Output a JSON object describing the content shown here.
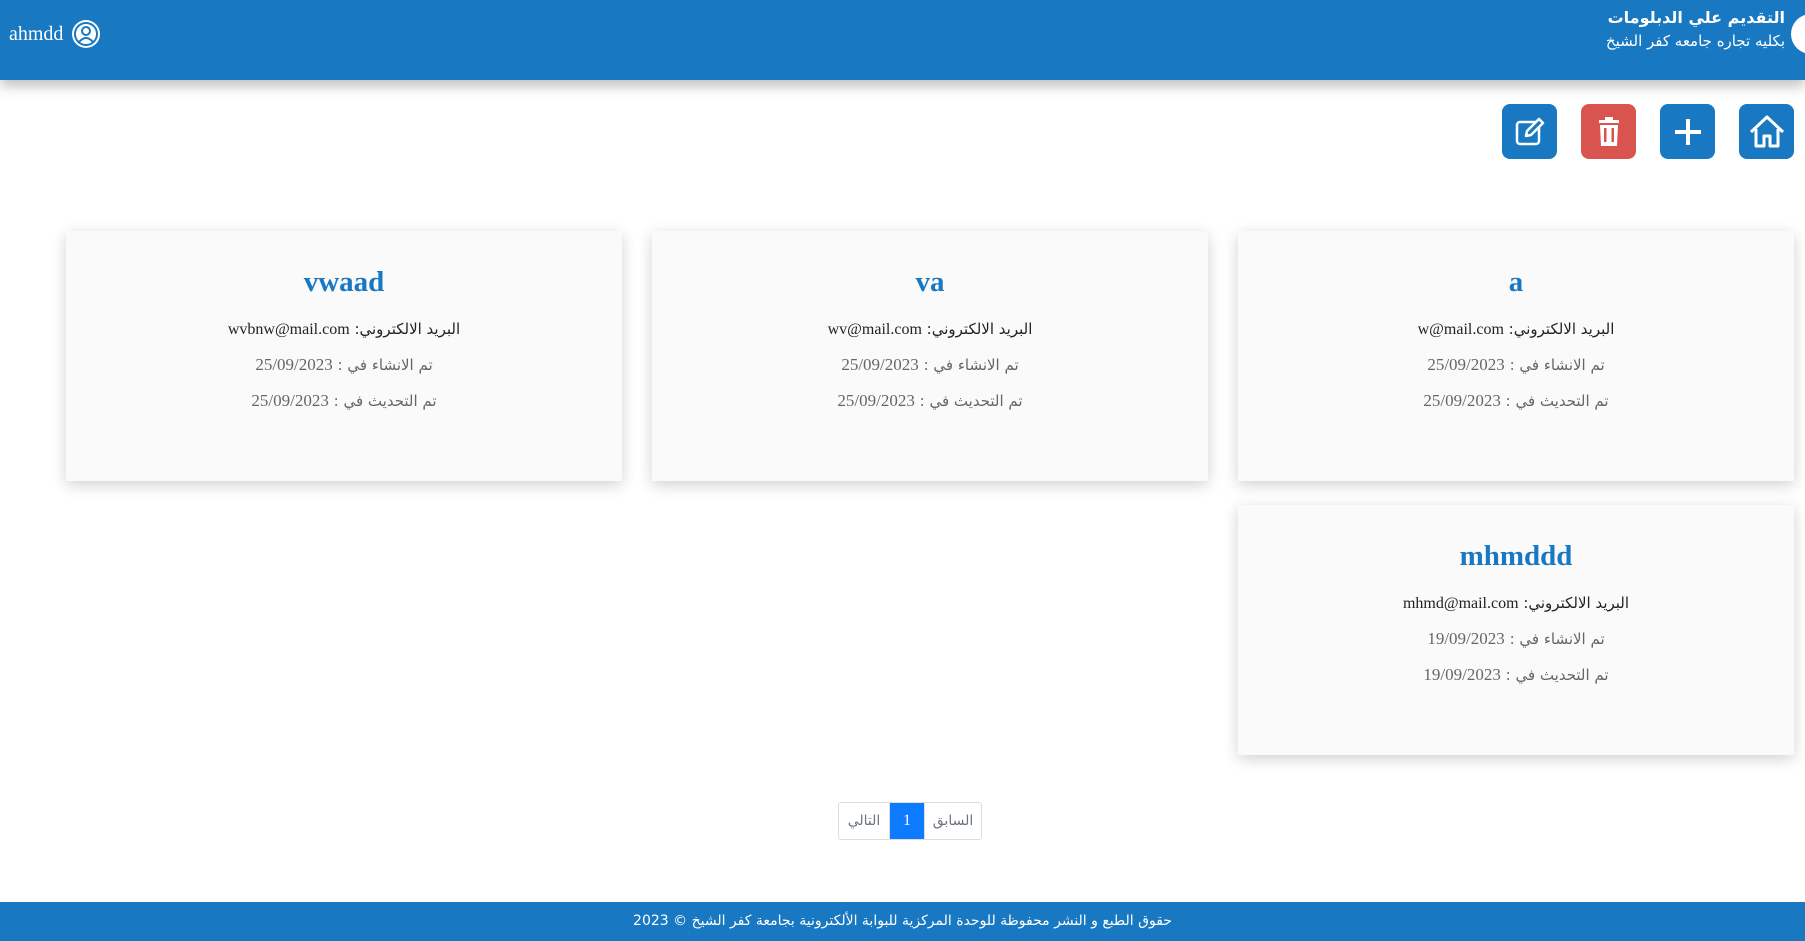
{
  "header": {
    "title": "التقديم علي الدبلومات",
    "subtitle": "بكليه تجاره جامعه كفر الشيخ",
    "user_name": "ahmdd",
    "user_icon": "user-circle-icon",
    "color": "#1878c2"
  },
  "toolbar": {
    "home_icon": "home-icon",
    "add_icon": "plus-icon",
    "delete_icon": "trash-icon",
    "edit_icon": "edit-icon",
    "delete_color": "#d9534f"
  },
  "cards": [
    {
      "name": "a",
      "email_label": "البريد الالكتروني:",
      "email": "w@mail.com",
      "created_label": "تم الانشاء في :",
      "created": "25/09/2023",
      "updated_label": "تم التحديث في :",
      "updated": "25/09/2023"
    },
    {
      "name": "va",
      "email_label": "البريد الالكتروني:",
      "email": "wv@mail.com",
      "created_label": "تم الانشاء في :",
      "created": "25/09/2023",
      "updated_label": "تم التحديث في :",
      "updated": "25/09/2023"
    },
    {
      "name": "vwaad",
      "email_label": "البريد الالكتروني:",
      "email": "wvbnw@mail.com",
      "created_label": "تم الانشاء في :",
      "created": "25/09/2023",
      "updated_label": "تم التحديث في :",
      "updated": "25/09/2023"
    },
    {
      "name": "mhmddd",
      "email_label": "البريد الالكتروني:",
      "email": "mhmd@mail.com",
      "created_label": "تم الانشاء في :",
      "created": "19/09/2023",
      "updated_label": "تم التحديث في :",
      "updated": "19/09/2023"
    }
  ],
  "pagination": {
    "prev_label": "السابق",
    "current": "1",
    "next_label": "التالي",
    "active_color": "#0d7bff"
  },
  "footer": {
    "text": "حقوق الطبع و النشر محفوظة للوحدة المركزية للبوابة الألكترونية بجامعة كفر الشيخ © 2023"
  }
}
